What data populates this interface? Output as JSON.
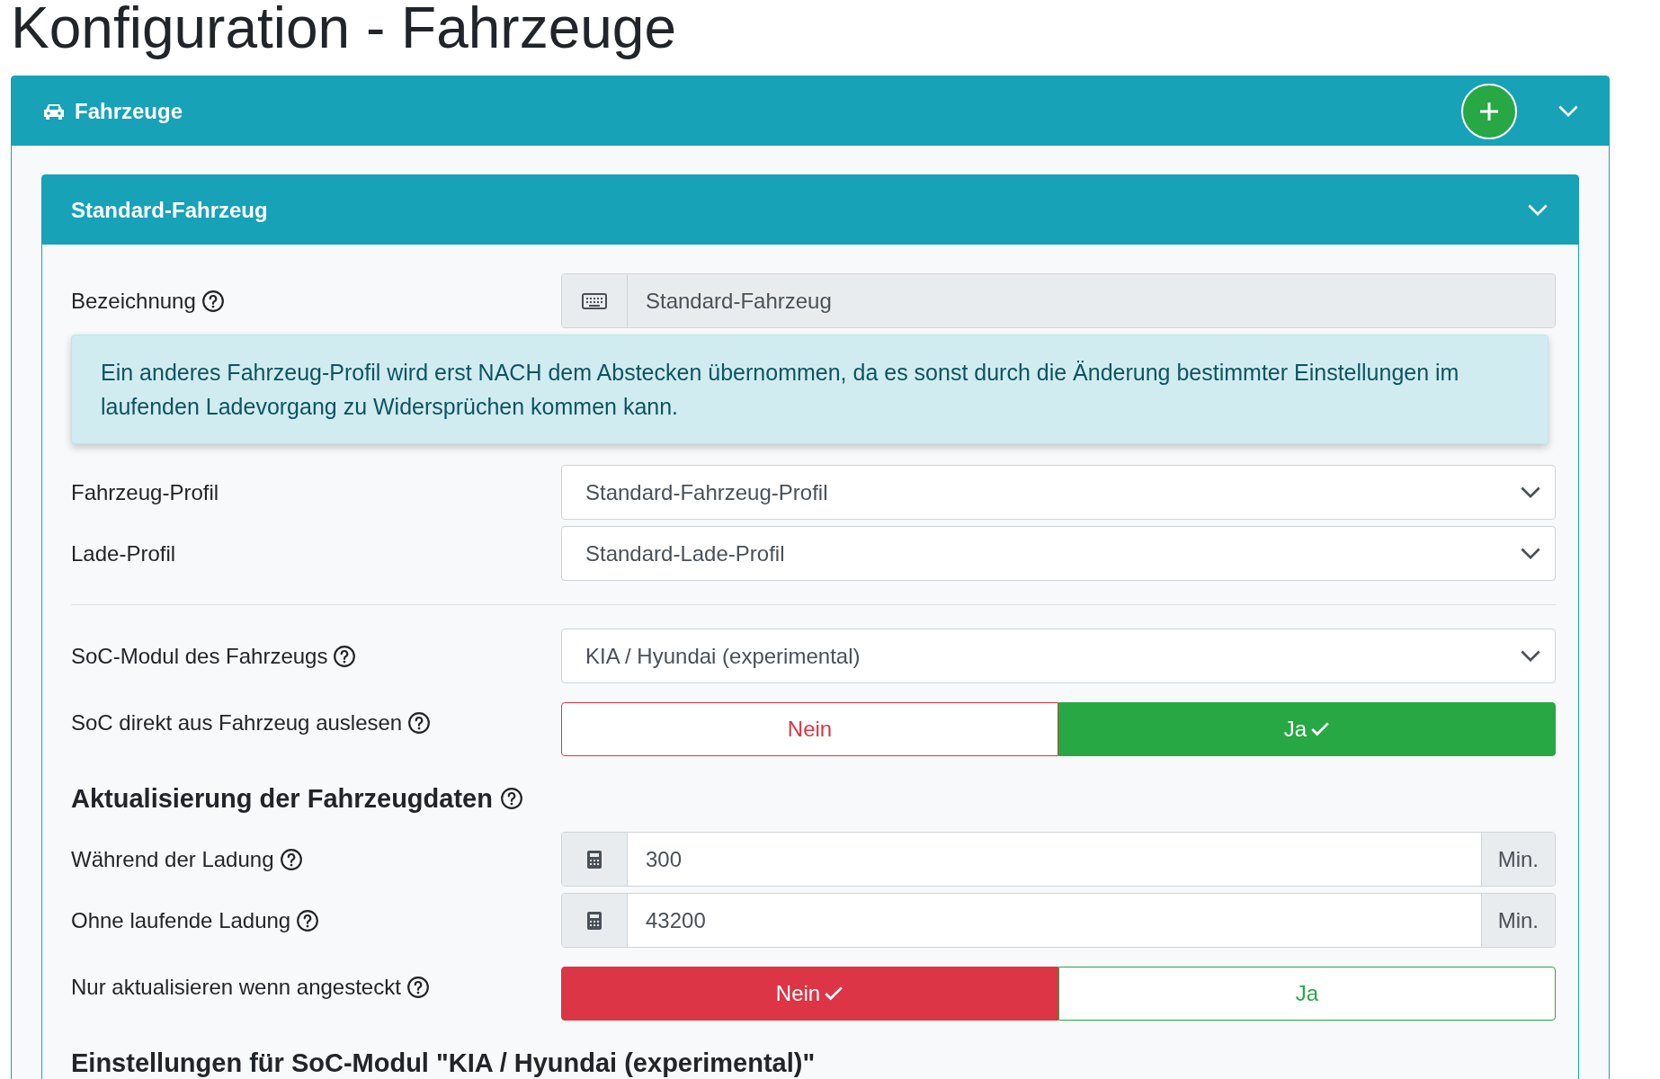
{
  "page_title": "Konfiguration - Fahrzeuge",
  "panel": {
    "title": "Fahrzeuge"
  },
  "vehicle": {
    "title": "Standard-Fahrzeug",
    "rows": [
      {
        "kind": "text",
        "label": "Bezeichnung",
        "help": true,
        "value": "Standard-Fahrzeug",
        "disabled": true
      },
      {
        "kind": "alert",
        "text": "Ein anderes Fahrzeug-Profil wird erst NACH dem Abstecken übernommen, da es sonst durch die Änderung bestimmter Einstellungen im laufenden Ladevorgang zu Widersprüchen kommen kann."
      },
      {
        "kind": "select",
        "label": "Fahrzeug-Profil",
        "help": false,
        "value": "Standard-Fahrzeug-Profil"
      },
      {
        "kind": "select",
        "label": "Lade-Profil",
        "help": false,
        "value": "Standard-Lade-Profil"
      },
      {
        "kind": "divider"
      },
      {
        "kind": "select",
        "label": "SoC-Modul des Fahrzeugs",
        "help": true,
        "value": "KIA / Hyundai (experimental)"
      },
      {
        "kind": "toggle",
        "label": "SoC direkt aus Fahrzeug auslesen",
        "help": true,
        "options": [
          {
            "label": "Nein",
            "color": "#dc3545",
            "selected": false
          },
          {
            "label": "Ja",
            "color": "#28a745",
            "selected": true
          }
        ]
      },
      {
        "kind": "heading",
        "label": "Aktualisierung der Fahrzeugdaten",
        "help": true
      },
      {
        "kind": "number",
        "label": "Während der Ladung",
        "help": true,
        "value": "300",
        "unit": "Min."
      },
      {
        "kind": "number",
        "label": "Ohne laufende Ladung",
        "help": true,
        "value": "43200",
        "unit": "Min."
      },
      {
        "kind": "toggle",
        "label": "Nur aktualisieren wenn angesteckt",
        "help": true,
        "options": [
          {
            "label": "Nein",
            "color": "#dc3545",
            "selected": true
          },
          {
            "label": "Ja",
            "color": "#28a745",
            "selected": false
          }
        ]
      },
      {
        "kind": "heading",
        "label": "Einstellungen für SoC-Modul \"KIA / Hyundai (experimental)\"",
        "help": false
      }
    ]
  }
}
